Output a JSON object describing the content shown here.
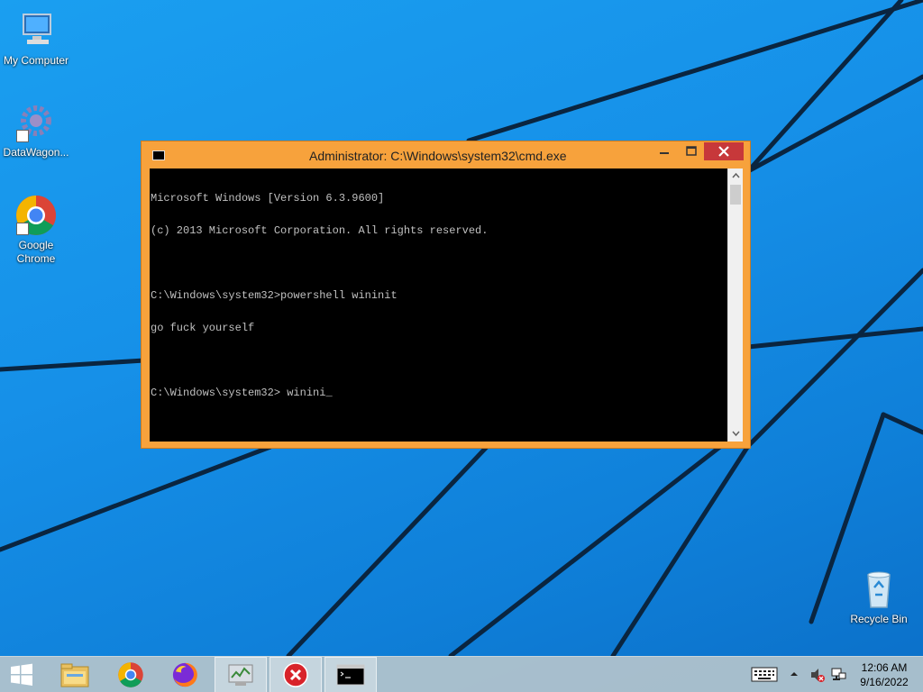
{
  "desktop": {
    "icons": [
      {
        "label": "My Computer"
      },
      {
        "label": "DataWagon..."
      },
      {
        "label": "Google Chrome"
      },
      {
        "label": "Recycle Bin"
      }
    ]
  },
  "window": {
    "title": "Administrator: C:\\Windows\\system32\\cmd.exe",
    "console_lines": [
      "Microsoft Windows [Version 6.3.9600]",
      "(c) 2013 Microsoft Corporation. All rights reserved.",
      "",
      "C:\\Windows\\system32>powershell wininit",
      "go fuck yourself",
      "",
      "C:\\Windows\\system32> winini"
    ]
  },
  "taskbar": {
    "clock_time": "12:06 AM",
    "clock_date": "9/16/2022"
  },
  "colors": {
    "window_frame": "#f7a23c",
    "close_button": "#c7383a",
    "console_bg": "#000000",
    "console_text": "#c0c0c0"
  },
  "icons": [
    "start-icon",
    "file-explorer-icon",
    "chrome-icon",
    "firefox-icon",
    "task-manager-icon",
    "error-icon",
    "cmd-icon",
    "keyboard-icon",
    "tray-chevron-icon",
    "volume-muted-icon",
    "network-icon"
  ]
}
